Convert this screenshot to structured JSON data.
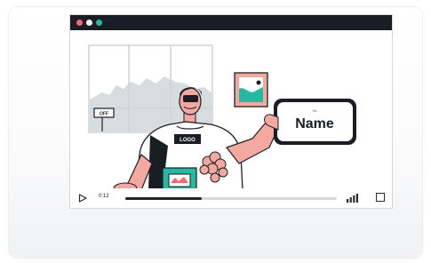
{
  "player": {
    "window_dots": [
      "#f26a6a",
      "#f5f5f5",
      "#27b8a4"
    ],
    "time_label": "0:12",
    "progress": 0.36,
    "icons": {
      "play": "play-icon",
      "volume": "volume-icon",
      "fullscreen": "fullscreen-icon"
    }
  },
  "illustration": {
    "shirt_label": "LOGO",
    "phone_small_text": "It's",
    "phone_name": "Name",
    "sign_text": "OFF",
    "colors": {
      "accent": "#27b8a4",
      "skin": "#f4a9a0",
      "ink": "#1b1d24"
    }
  }
}
